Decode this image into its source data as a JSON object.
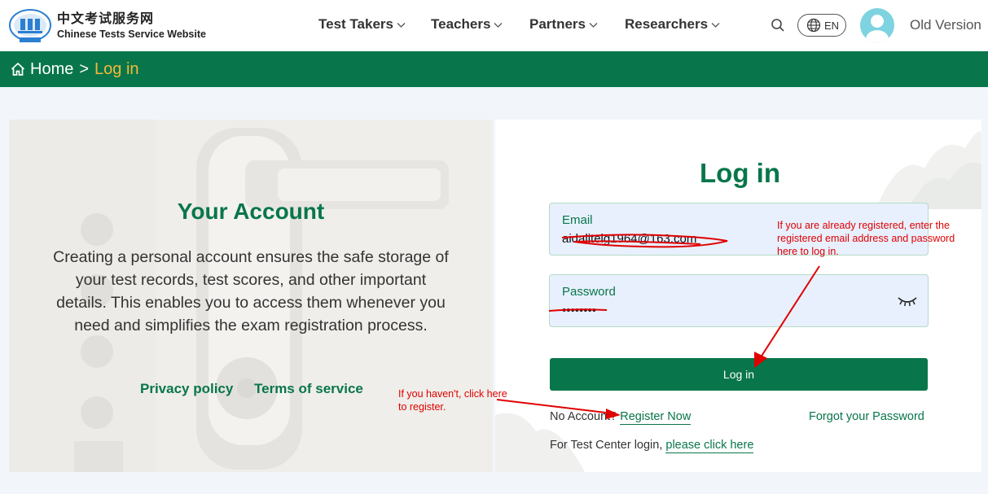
{
  "header": {
    "logo_cn": "中文考试服务网",
    "logo_en": "Chinese Tests Service Website",
    "nav": [
      {
        "label": "Test Takers"
      },
      {
        "label": "Teachers"
      },
      {
        "label": "Partners"
      },
      {
        "label": "Researchers"
      }
    ],
    "language": "EN",
    "old_version": "Old Version"
  },
  "breadcrumb": {
    "home": "Home",
    "separator": ">",
    "current": "Log in"
  },
  "account_panel": {
    "title": "Your Account",
    "description": "Creating a personal account ensures the safe storage of your test records, test scores, and other important details. This enables you to access them whenever you need and simplifies the exam registration process.",
    "privacy_link": "Privacy policy",
    "terms_link": "Terms of service"
  },
  "login": {
    "title": "Log in",
    "email_label": "Email",
    "email_value": "aidaliteig1964@163.com",
    "password_label": "Password",
    "password_value": "••••••••",
    "login_button": "Log in",
    "no_account_text": "No Account?",
    "register_link": "Register Now",
    "forgot_link": "Forgot your Password",
    "test_center_text": "For Test Center login,",
    "test_center_link": "please click here"
  },
  "annotations": {
    "registered_note": "If you are already registered, enter the registered email address and password here to log in.",
    "register_note": "If you haven't, click here to register."
  },
  "colors": {
    "primary_green": "#08764a",
    "breadcrumb_current": "#f5b93a",
    "annotation_red": "#e00000"
  }
}
